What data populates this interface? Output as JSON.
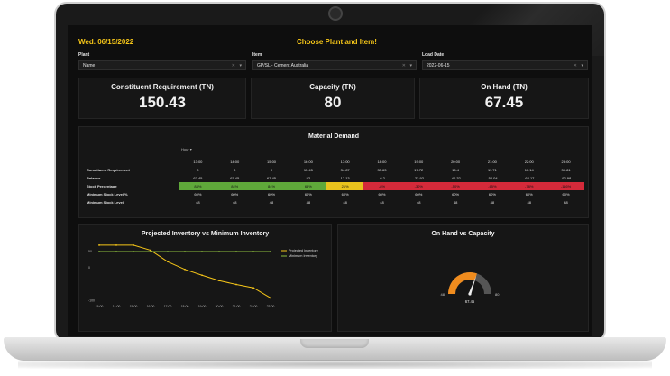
{
  "header": {
    "date": "Wed. 06/15/2022",
    "heading": "Choose Plant and Item!"
  },
  "filters": {
    "plant": {
      "label": "Plant",
      "value": "Name"
    },
    "item": {
      "label": "Item",
      "value": "GP/SL - Cement Australia"
    },
    "load_date": {
      "label": "Load Date",
      "value": "2022-06-15"
    }
  },
  "kpis": [
    {
      "title": "Constituent Requirement (TN)",
      "value": "150.43"
    },
    {
      "title": "Capacity (TN)",
      "value": "80"
    },
    {
      "title": "On Hand (TN)",
      "value": "67.45"
    }
  ],
  "material_demand": {
    "title": "Material Demand",
    "hour_chip": "Hour ▾",
    "columns": [
      "13:00",
      "14:00",
      "15:00",
      "16:00",
      "17:00",
      "18:00",
      "19:00",
      "20:00",
      "21:00",
      "22:00",
      "23:00"
    ],
    "rows": [
      {
        "label": "Constituent Requirement",
        "values": [
          "0",
          "0",
          "0",
          "15.45",
          "34.87",
          "33.63",
          "17.72",
          "16.4",
          "11.71",
          "10.14",
          "30.81"
        ]
      },
      {
        "label": "Balance",
        "values": [
          "67.45",
          "67.45",
          "67.45",
          "52",
          "17.13",
          "-6.2",
          "-23.92",
          "-40.32",
          "-52.04",
          "-62.17",
          "-92.98"
        ]
      },
      {
        "label": "Stock Percentage",
        "values": [
          "84%",
          "84%",
          "84%",
          "65%",
          "21%",
          "-8%",
          "-30%",
          "-50%",
          "-65%",
          "-78%",
          "-116%"
        ],
        "colors": [
          "#5fa83a",
          "#5fa83a",
          "#5fa83a",
          "#5fa83a",
          "#e9c31d",
          "#d42a3a",
          "#d42a3a",
          "#d42a3a",
          "#d42a3a",
          "#d42a3a",
          "#d42a3a"
        ]
      },
      {
        "label": "Minimum Stock Level %",
        "values": [
          "60%",
          "60%",
          "60%",
          "60%",
          "60%",
          "60%",
          "60%",
          "60%",
          "60%",
          "60%",
          "60%"
        ]
      },
      {
        "label": "Minimum Stock Level",
        "values": [
          "48",
          "48",
          "48",
          "48",
          "48",
          "48",
          "48",
          "48",
          "48",
          "48",
          "48"
        ]
      }
    ]
  },
  "chart_data": {
    "type": "line",
    "title": "Projected Inventory vs Minimum Inventory",
    "x": [
      "15:00",
      "16:00",
      "17:00",
      "18:00",
      "19:00",
      "20:00",
      "21:00",
      "22:00",
      "23:00"
    ],
    "categories_shown": [
      "15:00",
      "14:00",
      "15:00",
      "16:00",
      "17:00",
      "18:00",
      "19:00",
      "20:00",
      "21:00",
      "22:00",
      "23:00"
    ],
    "yticks": [
      "50",
      "0",
      "-100"
    ],
    "ylim": [
      -100,
      70
    ],
    "series": [
      {
        "name": "Projected Inventory",
        "color": "#f5c518",
        "values": [
          67.45,
          67.45,
          67.45,
          52,
          17.13,
          -6.2,
          -23.92,
          -40.32,
          -52.04,
          -62.17,
          -92.98
        ]
      },
      {
        "name": "Minimum Inventory",
        "color": "#8fbf3f",
        "values": [
          48,
          48,
          48,
          48,
          48,
          48,
          48,
          48,
          48,
          48,
          48
        ]
      }
    ],
    "legend": "top-right"
  },
  "gauge": {
    "title": "On Hand vs Capacity",
    "value": 67.45,
    "value_label": "67.45",
    "min_label": "48",
    "max_label": "80",
    "min": 48,
    "max": 80,
    "fill_color": "#f08c1e",
    "track_color": "#555555"
  }
}
